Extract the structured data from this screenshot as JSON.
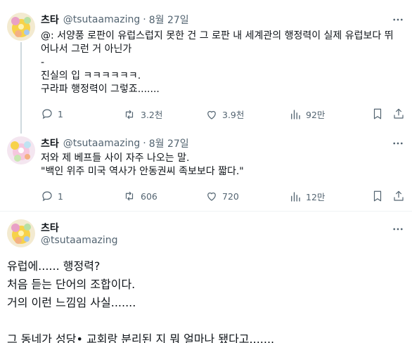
{
  "posts": [
    {
      "name": "츠타",
      "handle": "@tsutaamazing",
      "time": "8월 27일",
      "text": "@: 서양풍 로판이 유럽스럽지 못한 건 그 로판 내 세계관의 행정력이 실제 유럽보다 뛰\n어나서 그런 거 아닌가\n-\n진실의 입 ㅋㅋㅋㅋㅋㅋ.\n구라파 행정력이 그렇죠.......",
      "replies": "1",
      "reposts": "3.2천",
      "likes": "3.9천",
      "views": "92만"
    },
    {
      "name": "츠타",
      "handle": "@tsutaamazing",
      "time": "8월 27일",
      "text": "저와 제 베프들 사이 자주 나오는 말.\n\"백인 위주 미국 역사가 안동권씨 족보보다 짧다.\"",
      "replies": "1",
      "reposts": "606",
      "likes": "720",
      "views": "12만"
    }
  ],
  "main_post": {
    "name": "츠타",
    "handle": "@tsutaamazing",
    "text": "유럽에...... 행정력?\n처음 듣는 단어의 조합이다.\n거의 이런 느낌임 사실.......\n\n그 동네가 성당• 교회랑 분리된 지 뭐 얼마나 됐다고......."
  },
  "icons": [
    "more-icon",
    "reply-icon",
    "repost-icon",
    "like-icon",
    "views-icon",
    "bookmark-icon",
    "share-icon"
  ],
  "colors": {
    "text": "#0f1419",
    "muted": "#536471",
    "divider": "#eff3f4",
    "thread": "#cfd9de"
  }
}
